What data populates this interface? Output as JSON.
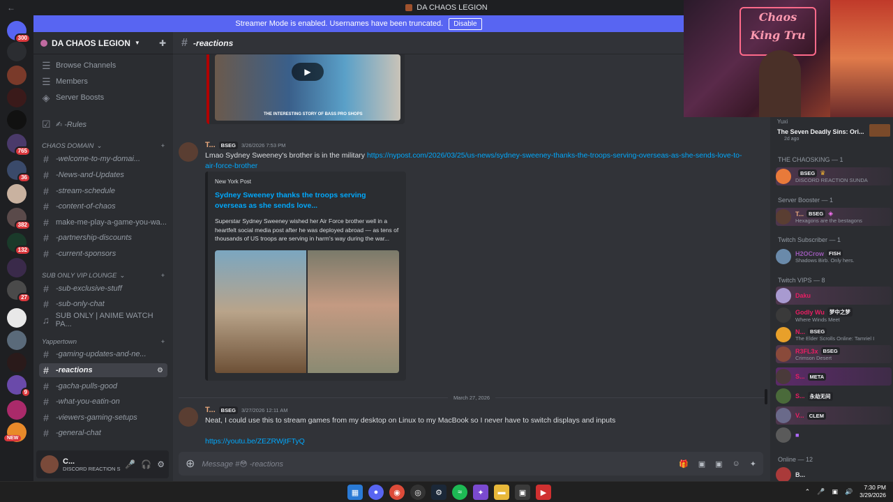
{
  "window": {
    "title": "DA CHAOS LEGION"
  },
  "banner": {
    "text": "Streamer Mode is enabled. Usernames have been truncated.",
    "button": "Disable"
  },
  "rail": {
    "badges": [
      "300",
      "765",
      "36",
      "382",
      "132",
      "27",
      "9"
    ],
    "new_label": "NEW"
  },
  "sidebar": {
    "guild_name": "DA CHAOS LEGION",
    "top_items": [
      "Browse Channels",
      "Members",
      "Server Boosts"
    ],
    "rules": "✍ -Rules",
    "cat1": "CHAOS DOMAIN",
    "cat1_channels": [
      "-welcome-to-my-domai...",
      "-News-and-Updates",
      "-stream-schedule",
      "-content-of-chaos",
      "make-me-play-a-game-you-wa...",
      "-partnership-discounts",
      "-current-sponsors"
    ],
    "cat2": "SUB ONLY VIP LOUNGE",
    "cat2_channels": [
      "-sub-exclusive-stuff",
      "-sub-only-chat",
      "SUB ONLY | ANIME WATCH PA..."
    ],
    "cat3": "Yappertown",
    "cat3_channels": [
      "-gaming-updates-and-ne...",
      "-reactions",
      "-gacha-pulls-good",
      "-what-you-eatin-on",
      "-viewers-gaming-setups",
      "-general-chat"
    ],
    "user": {
      "name": "C...",
      "status": "DISCORD REACTION S"
    }
  },
  "channel": {
    "name": "-reactions",
    "composer_placeholder": "Message #😳 -reactions"
  },
  "messages": [
    {
      "author": "T...",
      "tag": "BSEG",
      "time": "3/26/2026 7:53 PM",
      "text": "Lmao Sydney Sweeney's brother is in the military ",
      "link": "https://nypost.com/2026/03/25/us-news/sydney-sweeney-thanks-the-troops-serving-overseas-as-she-sends-love-to-air-force-brother",
      "embed": {
        "provider": "New York Post",
        "title": "Sydney Sweeney thanks the troops serving overseas as she sends love...",
        "desc": "Superstar Sydney Sweeney wished her Air Force brother well in a heartfelt social media post after he was deployed abroad — as tens of thousands of US troops are serving in harm's way during the war..."
      }
    },
    {
      "author": "T...",
      "tag": "BSEG",
      "time": "3/27/2026 12:11 AM",
      "text": "Neat, I could use this to stream games from my desktop on Linux to my MacBook so I never have to switch displays and inputs",
      "link": "https://youtu.be/ZEZRWjtFTyQ"
    }
  ],
  "top_embed_caption": "THE INTERESTING STORY OF BASS PRO SHOPS",
  "date_divider": "March 27, 2026",
  "members": {
    "activity": {
      "name": "Yuxi",
      "game": "The Seven Deadly Sins: Ori...",
      "time": "2d ago"
    },
    "groups": [
      {
        "header": "THE CHAOSKING — 1",
        "members": [
          {
            "name": "",
            "tag": "BSEG",
            "status": "DISCORD REACTION SUNDA",
            "color": "#e53935"
          }
        ]
      },
      {
        "header": "Server Booster — 1",
        "members": [
          {
            "name": "T...",
            "tag": "BSEG",
            "status": "Hexagons are the bestagons",
            "color": "#e8a87c"
          }
        ]
      },
      {
        "header": "Twitch Subscriber — 1",
        "members": [
          {
            "name": "H2OCrow",
            "tag": "FISH",
            "status": "Shadows Birb. Only hers.",
            "color": "#9b59b6"
          }
        ]
      },
      {
        "header": "Twitch VIPS — 8",
        "members": [
          {
            "name": "Daku",
            "tag": "",
            "status": "",
            "color": "#e91e63"
          },
          {
            "name": "Godly Wu",
            "tag": "梦中之梦",
            "status": "Where Winds Meet",
            "color": "#e91e63"
          },
          {
            "name": "N...",
            "tag": "BSEG",
            "status": "The Elder Scrolls Online: Tamriel I",
            "color": "#e91e63"
          },
          {
            "name": "R3FL3x",
            "tag": "BSEG",
            "status": "Crimson Desert",
            "color": "#e91e63"
          },
          {
            "name": "S...",
            "tag": "META",
            "status": "",
            "color": "#e91e63"
          },
          {
            "name": "S...",
            "tag": "永劫无间",
            "status": "",
            "color": "#e91e63"
          },
          {
            "name": "V...",
            "tag": "CLEM",
            "status": "",
            "color": "#e91e63"
          },
          {
            "name": "",
            "tag": "",
            "status": "",
            "color": "#e91e63"
          }
        ]
      },
      {
        "header": "Online — 12",
        "members": [
          {
            "name": "B...",
            "tag": "",
            "status": "",
            "color": "#dbdee1"
          }
        ]
      }
    ]
  },
  "webcam": {
    "sign_line1": "Chaos",
    "sign_line2": "King Tru"
  },
  "taskbar": {
    "time": "7:30 PM",
    "date": "3/29/2026"
  },
  "colors": {
    "accent": "#5865f2",
    "link": "#00a8fc",
    "bg_main": "#313338",
    "bg_sidebar": "#2b2d31"
  }
}
